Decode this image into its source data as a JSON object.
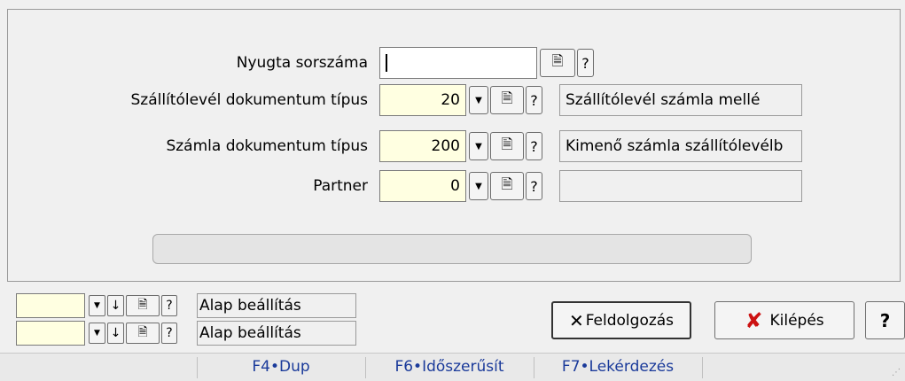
{
  "form": {
    "rows": [
      {
        "label": "Nyugta sorszáma",
        "value": "",
        "description": ""
      },
      {
        "label": "Szállítólevél dokumentum típus",
        "value": "20",
        "description": "Szállítólevél számla mellé"
      },
      {
        "label": "Számla dokumentum típus",
        "value": "200",
        "description": "Kimenő számla szállítólevélb"
      },
      {
        "label": "Partner",
        "value": "0",
        "description": ""
      }
    ],
    "help_glyph": "?",
    "progress": 0
  },
  "settings": [
    {
      "value": "",
      "label": "Alap beállítás"
    },
    {
      "value": "",
      "label": "Alap beállítás"
    }
  ],
  "buttons": {
    "process_label": "Feldolgozás",
    "exit_label": "Kilépés",
    "help_label": "?"
  },
  "statusbar": {
    "items": [
      "F4•Dup",
      "F6•Időszerűsít",
      "F7•Lekérdezés"
    ]
  },
  "colors": {
    "yellow_field": "#ffffe1",
    "exit_icon": "#cc1111",
    "status_text": "#1a3a9a"
  }
}
